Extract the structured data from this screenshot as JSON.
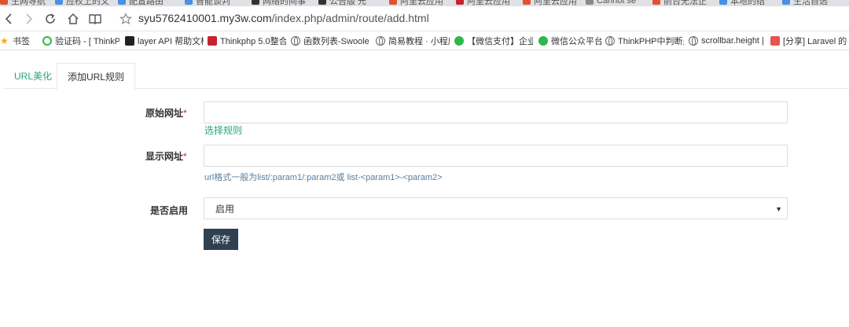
{
  "browser": {
    "tabs": [
      {
        "label": "生网导航",
        "color": "#e0522d"
      },
      {
        "label": "应权上的文",
        "color": "#4a90e2"
      },
      {
        "label": "配置路由",
        "color": "#4a90e2"
      },
      {
        "label": "智能谈判",
        "color": "#4a90e2"
      },
      {
        "label": "网络的间事",
        "color": "#333333"
      },
      {
        "label": "公告版 元",
        "color": "#333333"
      },
      {
        "label": "阿里云应用",
        "color": "#e0522d"
      },
      {
        "label": "阿里云应用",
        "color": "#c8232c"
      },
      {
        "label": "阿里云应用",
        "color": "#e0522d"
      },
      {
        "label": "Cannot se",
        "color": "#888888"
      },
      {
        "label": "前台无法正",
        "color": "#e0522d"
      },
      {
        "label": "本地的结",
        "color": "#4a90e2"
      },
      {
        "label": "生活自选",
        "color": "#4a90e2"
      }
    ],
    "url_host": "syu5762410001.my3w.com",
    "url_path": "/index.php/admin/route/add.html"
  },
  "bookmarks": [
    {
      "label": "书签",
      "icon": "star-icon",
      "color": "#f5a623"
    },
    {
      "label": "验证码 - [ ThinkPHP",
      "icon": "ring-icon",
      "color": "#2db84b"
    },
    {
      "label": "layer API 帮助文档",
      "icon": "layer-icon",
      "color": "#222222"
    },
    {
      "label": "Thinkphp 5.0整合",
      "icon": "c-icon",
      "color": "#c8232c"
    },
    {
      "label": "函数列表-Swoole",
      "icon": "globe-icon",
      "color": "#666666"
    },
    {
      "label": "简易教程 · 小程序",
      "icon": "globe-icon",
      "color": "#666666"
    },
    {
      "label": "【微信支付】企业",
      "icon": "wechat-icon",
      "color": "#2db84b"
    },
    {
      "label": "微信公众平台",
      "icon": "wechat-icon",
      "color": "#2db84b"
    },
    {
      "label": "ThinkPHP中判断是",
      "icon": "globe-icon",
      "color": "#666666"
    },
    {
      "label": "scrollbar.height |",
      "icon": "globe-icon",
      "color": "#666666"
    },
    {
      "label": "[分享] Laravel 的",
      "icon": "laravel-icon",
      "color": "#e8524f"
    }
  ],
  "tabs": {
    "url_beautify": "URL美化",
    "add_rule": "添加URL规则"
  },
  "form": {
    "original_url_label": "原始网址",
    "original_url_value": "",
    "select_rule_link": "选择规则",
    "display_url_label": "显示网址",
    "display_url_value": "",
    "url_hint": "url格式一般为list/:param1/:param2或 list-<param1>-<param2>",
    "enabled_label": "是否启用",
    "enabled_value": "启用",
    "required_mark": "*",
    "save_label": "保存"
  },
  "colors": {
    "accent": "#1fa67a",
    "button": "#2f4050",
    "required": "#e02020"
  }
}
